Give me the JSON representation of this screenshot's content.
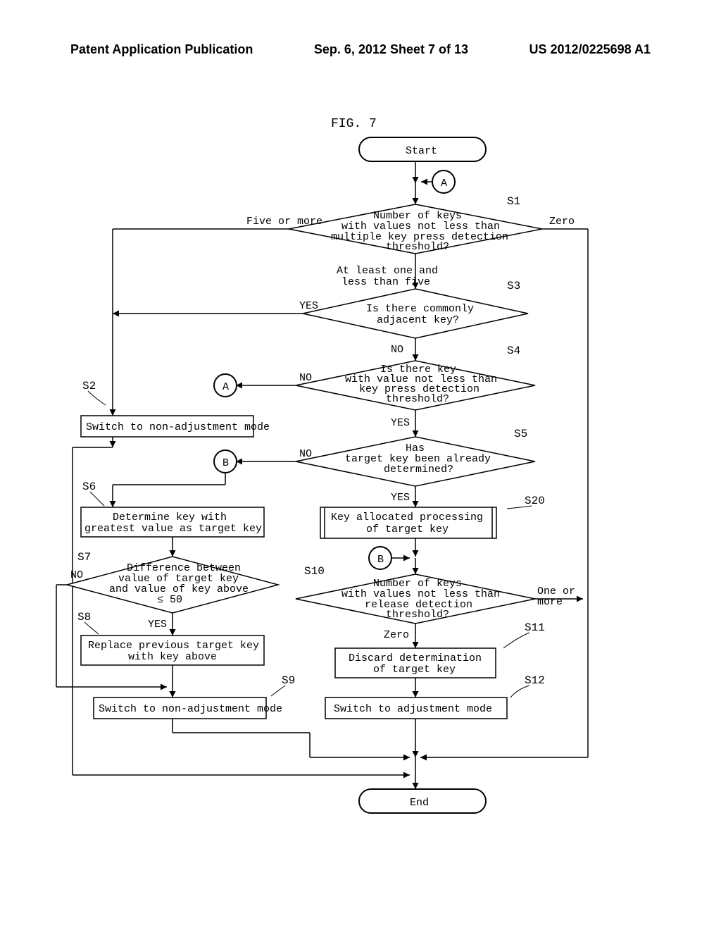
{
  "header": {
    "left": "Patent Application Publication",
    "center": "Sep. 6, 2012   Sheet 7 of 13",
    "right": "US 2012/0225698 A1"
  },
  "figure_title": "FIG. 7",
  "terminals": {
    "start": "Start",
    "end": "End"
  },
  "connectors": {
    "A1": "A",
    "A2": "A",
    "B1": "B",
    "B2": "B"
  },
  "step_labels": {
    "s1": "S1",
    "s2": "S2",
    "s3": "S3",
    "s4": "S4",
    "s5": "S5",
    "s6": "S6",
    "s7": "S7",
    "s8": "S8",
    "s9": "S9",
    "s10": "S10",
    "s11": "S11",
    "s12": "S12",
    "s20": "S20"
  },
  "decisions": {
    "s1": {
      "line1": "Number of keys",
      "line2": "with values not less than",
      "line3": "multiple key press detection",
      "line4": "threshold?"
    },
    "s3": {
      "line1": "Is there commonly",
      "line2": "adjacent key?"
    },
    "s4": {
      "line1": "Is there key",
      "line2": "with value not less than",
      "line3": "key press detection",
      "line4": "threshold?"
    },
    "s5": {
      "line1": "Has",
      "line2": "target key been already",
      "line3": "determined?"
    },
    "s7": {
      "line1": "Difference between",
      "line2": "value of target key",
      "line3": "and value of key above",
      "line4": "≤ 50"
    },
    "s10": {
      "line1": "Number of keys",
      "line2": "with values not less than",
      "line3": "release detection",
      "line4": "threshold?"
    }
  },
  "processes": {
    "s2": "Switch to non-adjustment mode",
    "s6": {
      "line1": "Determine key with",
      "line2": "greatest value as target key"
    },
    "s8": {
      "line1": "Replace previous target key",
      "line2": "with key above"
    },
    "s9": "Switch to non-adjustment mode",
    "s11": {
      "line1": "Discard determination",
      "line2": "of target key"
    },
    "s12": "Switch to adjustment mode",
    "s20": {
      "line1": "Key allocated processing",
      "line2": "of target key"
    }
  },
  "branch_labels": {
    "s1_left": "Five or more",
    "s1_mid_line1": "At least one and",
    "s1_mid_line2": "less than five",
    "s1_right": "Zero",
    "s3_yes": "YES",
    "s3_no": "NO",
    "s4_yes": "YES",
    "s4_no": "NO",
    "s5_yes": "YES",
    "s5_no": "NO",
    "s7_yes": "YES",
    "s7_no": "NO",
    "s10_right_line1": "One or",
    "s10_right_line2": "more",
    "s10_zero": "Zero"
  },
  "chart_data": {
    "type": "flowchart",
    "nodes": [
      {
        "id": "start",
        "kind": "terminal",
        "label": "Start"
      },
      {
        "id": "A_top",
        "kind": "connector",
        "label": "A"
      },
      {
        "id": "S1",
        "kind": "decision",
        "label": "Number of keys with values not less than multiple key press detection threshold?"
      },
      {
        "id": "S2",
        "kind": "process",
        "label": "Switch to non-adjustment mode"
      },
      {
        "id": "S3",
        "kind": "decision",
        "label": "Is there commonly adjacent key?"
      },
      {
        "id": "A_mid",
        "kind": "connector",
        "label": "A"
      },
      {
        "id": "S4",
        "kind": "decision",
        "label": "Is there key with value not less than key press detection threshold?"
      },
      {
        "id": "S5",
        "kind": "decision",
        "label": "Has target key been already determined?"
      },
      {
        "id": "S6",
        "kind": "process",
        "label": "Determine key with greatest value as target key"
      },
      {
        "id": "S7",
        "kind": "decision",
        "label": "Difference between value of target key and value of key above ≤ 50"
      },
      {
        "id": "S8",
        "kind": "process",
        "label": "Replace previous target key with key above"
      },
      {
        "id": "S9",
        "kind": "process",
        "label": "Switch to non-adjustment mode"
      },
      {
        "id": "B_left",
        "kind": "connector",
        "label": "B"
      },
      {
        "id": "S20",
        "kind": "subroutine",
        "label": "Key allocated processing of target key"
      },
      {
        "id": "B_right",
        "kind": "connector",
        "label": "B"
      },
      {
        "id": "S10",
        "kind": "decision",
        "label": "Number of keys with values not less than release detection threshold?"
      },
      {
        "id": "S11",
        "kind": "process",
        "label": "Discard determination of target key"
      },
      {
        "id": "S12",
        "kind": "process",
        "label": "Switch to adjustment mode"
      },
      {
        "id": "end",
        "kind": "terminal",
        "label": "End"
      }
    ],
    "edges": [
      {
        "from": "start",
        "to": "A_top"
      },
      {
        "from": "A_top",
        "to": "S1"
      },
      {
        "from": "S1",
        "to": "S2",
        "label": "Five or more"
      },
      {
        "from": "S1",
        "to": "S3",
        "label": "At least one and less than five"
      },
      {
        "from": "S1",
        "to": "end",
        "label": "Zero"
      },
      {
        "from": "S2",
        "to": "end"
      },
      {
        "from": "S3",
        "to": "S2",
        "label": "YES"
      },
      {
        "from": "S3",
        "to": "S4",
        "label": "NO"
      },
      {
        "from": "S4",
        "to": "A_mid",
        "label": "NO"
      },
      {
        "from": "S4",
        "to": "S5",
        "label": "YES"
      },
      {
        "from": "S5",
        "to": "B_left",
        "label": "NO"
      },
      {
        "from": "S5",
        "to": "S20",
        "label": "YES"
      },
      {
        "from": "B_left",
        "to": "S6"
      },
      {
        "from": "S6",
        "to": "S7"
      },
      {
        "from": "S7",
        "to": "S9",
        "label": "NO"
      },
      {
        "from": "S7",
        "to": "S8",
        "label": "YES"
      },
      {
        "from": "S8",
        "to": "S9"
      },
      {
        "from": "S9",
        "to": "end"
      },
      {
        "from": "S20",
        "to": "B_right"
      },
      {
        "from": "B_right",
        "to": "S10"
      },
      {
        "from": "S10",
        "to": "end",
        "label": "One or more"
      },
      {
        "from": "S10",
        "to": "S11",
        "label": "Zero"
      },
      {
        "from": "S11",
        "to": "S12"
      },
      {
        "from": "S12",
        "to": "end"
      }
    ]
  }
}
